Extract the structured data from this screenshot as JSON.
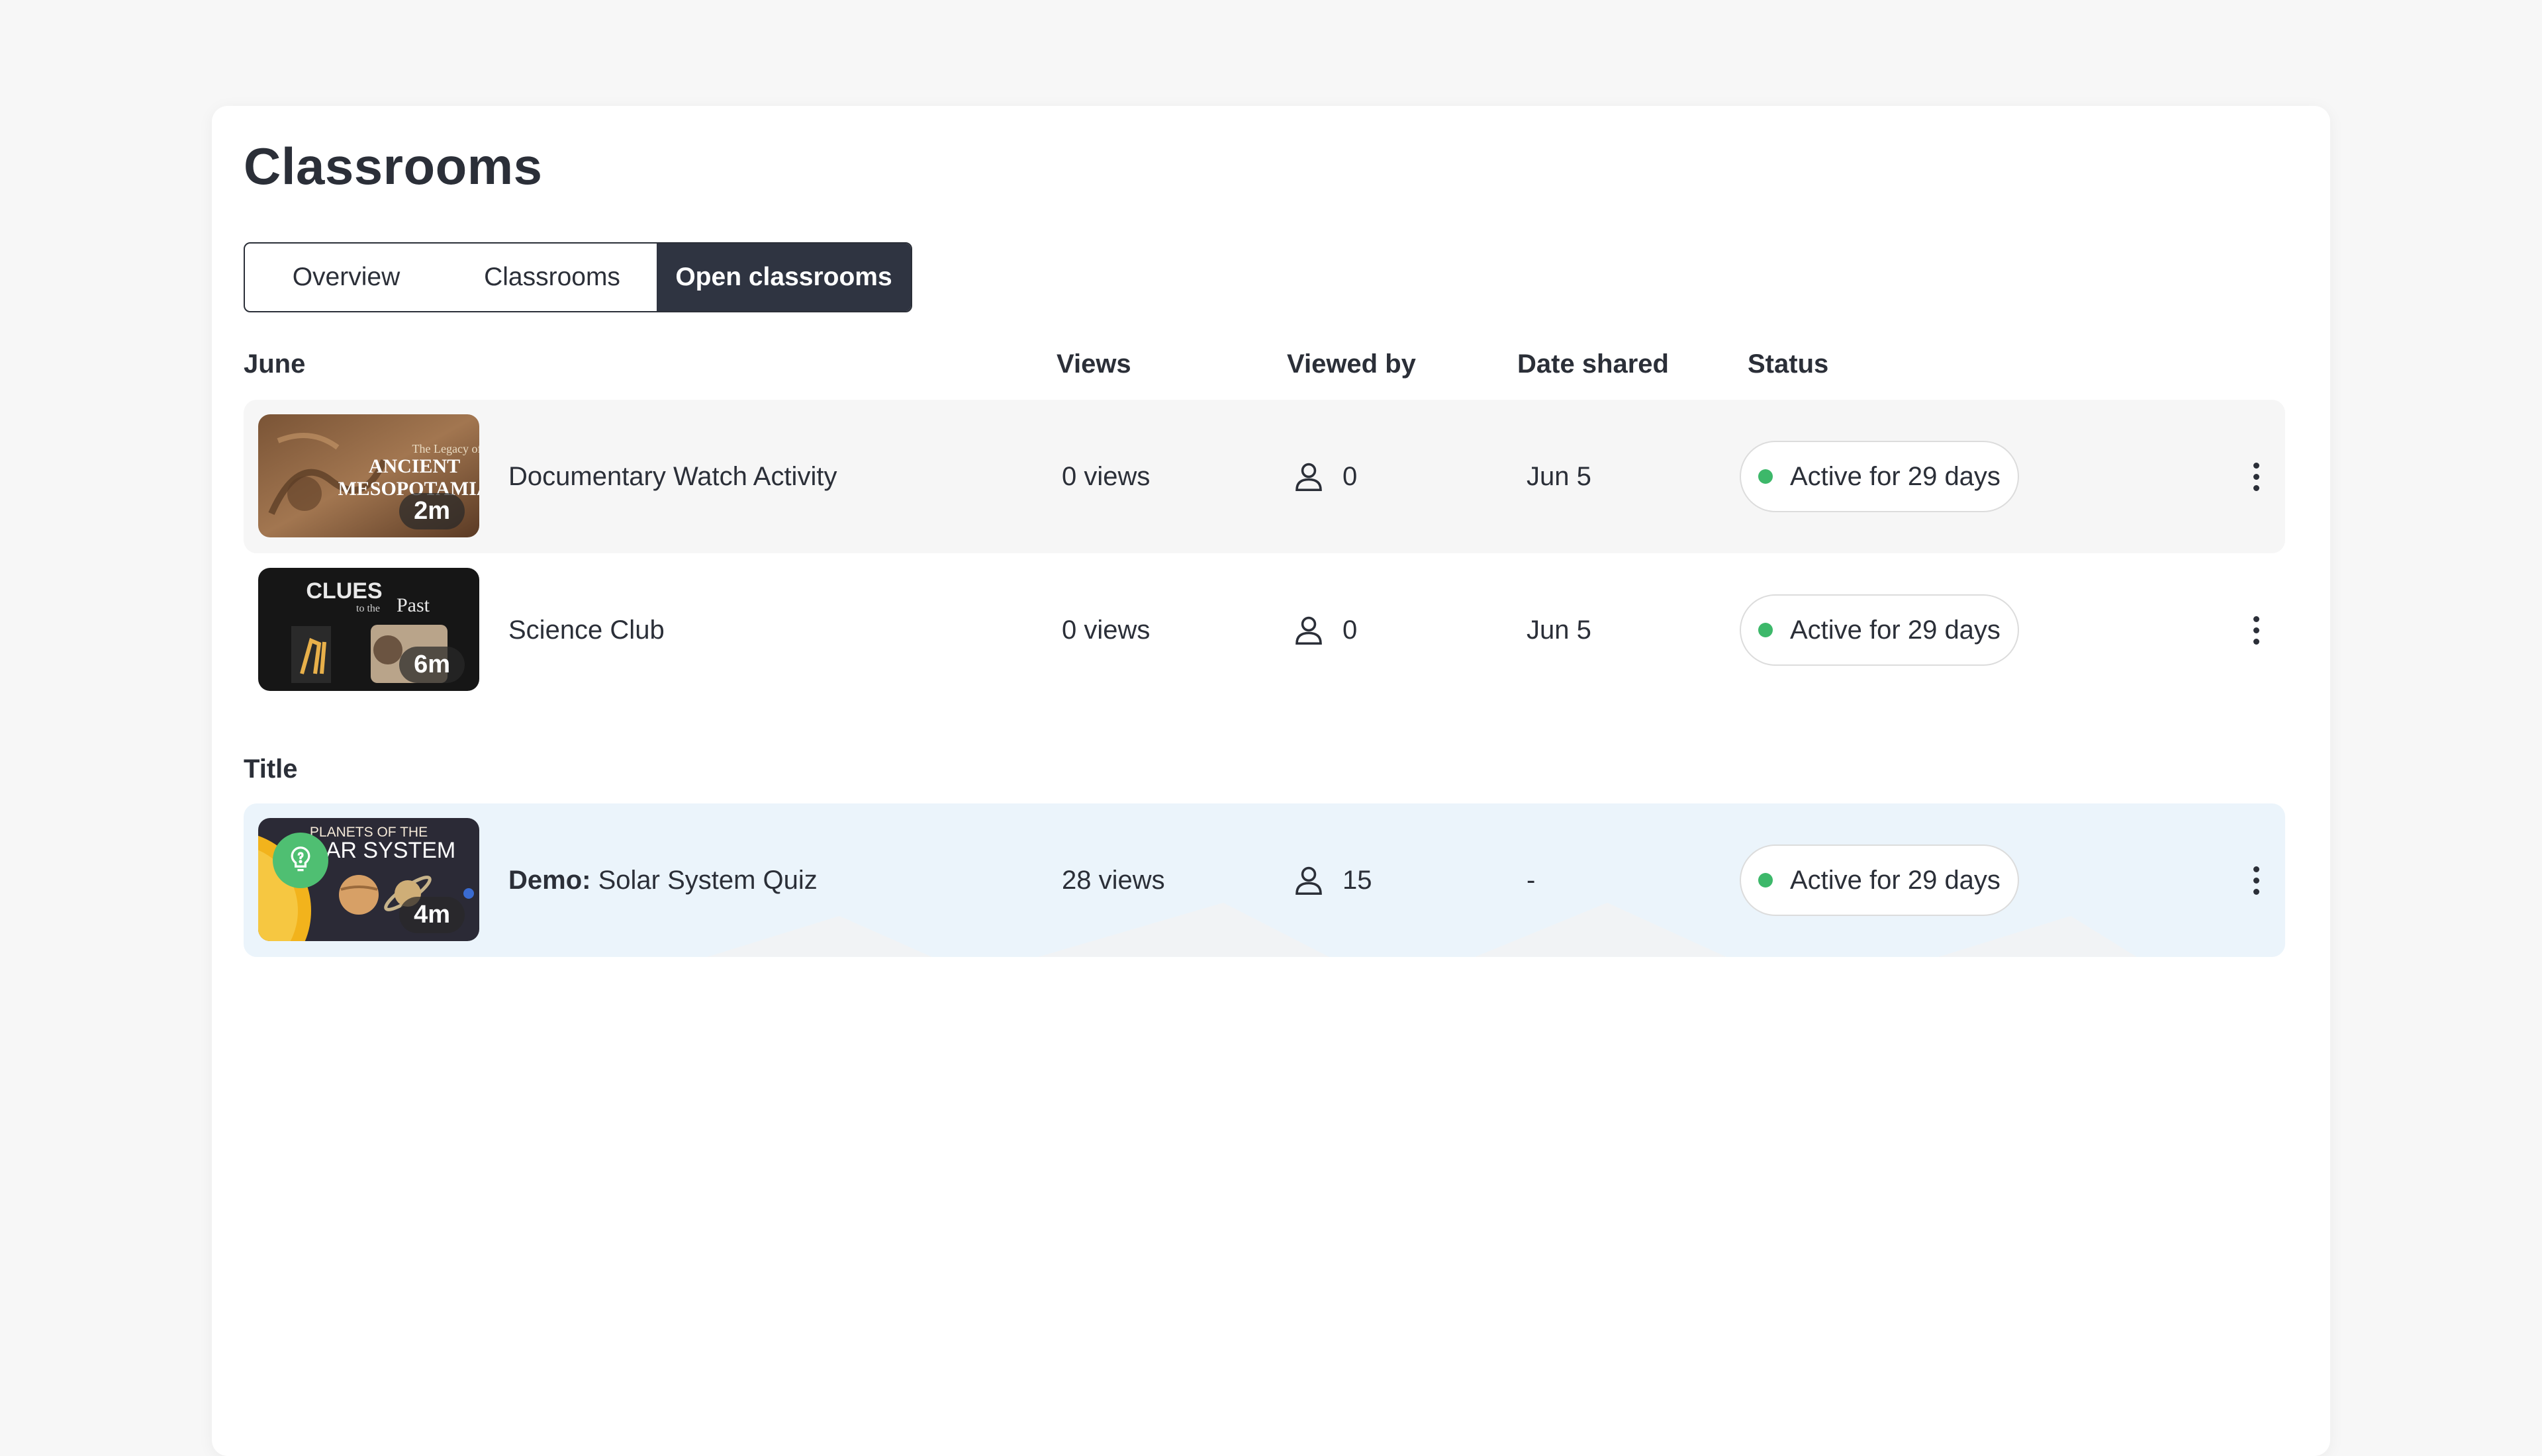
{
  "page": {
    "title": "Classrooms"
  },
  "tabs": [
    {
      "label": "Overview",
      "active": false
    },
    {
      "label": "Classrooms",
      "active": false
    },
    {
      "label": "Open classrooms",
      "active": true
    }
  ],
  "columns": {
    "group1": "June",
    "views": "Views",
    "viewed_by": "Viewed by",
    "date_shared": "Date shared",
    "status": "Status"
  },
  "group2": {
    "label": "Title"
  },
  "rows": [
    {
      "thumb_text_1": "The Legacy of",
      "thumb_text_2": "ANCIENT",
      "thumb_text_3": "MESOPOTAMIA",
      "duration": "2m",
      "name": "Documentary Watch Activity",
      "views": "0 views",
      "viewed_by": "0",
      "date": "Jun 5",
      "status": "Active for 29 days"
    },
    {
      "thumb_text_1": "CLUES",
      "thumb_text_2": "to the",
      "thumb_text_3": "Past",
      "duration": "6m",
      "name": "Science Club",
      "views": "0 views",
      "viewed_by": "0",
      "date": "Jun 5",
      "status": "Active for 29 days"
    },
    {
      "thumb_text_1": "PLANETS OF THE",
      "thumb_text_2": "AR SYSTEM",
      "duration": "4m",
      "name_prefix": "Demo:",
      "name": "Solar System Quiz",
      "views": "28 views",
      "viewed_by": "15",
      "date": "-",
      "status": "Active for 29 days"
    }
  ],
  "colors": {
    "dark": "#2f3441",
    "active_dot": "#3db86a",
    "row_gray": "#f6f6f6",
    "row_highlight": "#ebf4fb"
  },
  "icons": [
    "person-icon",
    "more-vertical-icon",
    "quiz-bulb-icon"
  ]
}
